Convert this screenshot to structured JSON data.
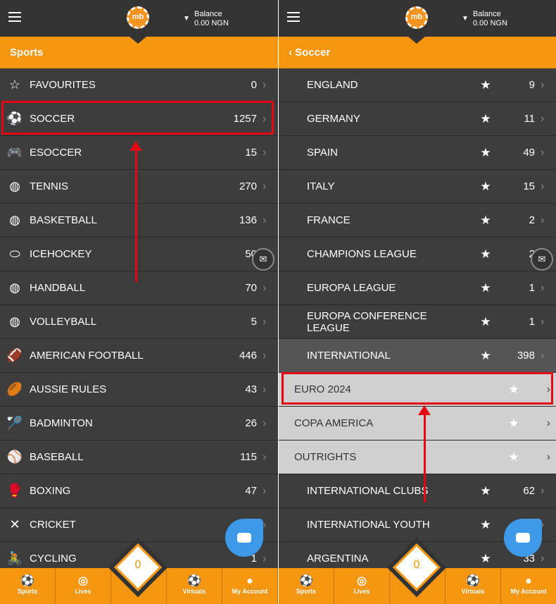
{
  "header": {
    "logo": "mb",
    "balance_label": "Balance",
    "balance_value": "0.00 NGN"
  },
  "left": {
    "title": "Sports",
    "items": [
      {
        "icon": "star-outline-icon",
        "glyph": "☆",
        "label": "FAVOURITES",
        "count": "0"
      },
      {
        "icon": "soccer-ball-icon",
        "glyph": "⚽",
        "label": "SOCCER",
        "count": "1257"
      },
      {
        "icon": "gamepad-icon",
        "glyph": "🎮",
        "label": "ESOCCER",
        "count": "15"
      },
      {
        "icon": "tennis-icon",
        "glyph": "◍",
        "label": "TENNIS",
        "count": "270"
      },
      {
        "icon": "basketball-icon",
        "glyph": "◍",
        "label": "BASKETBALL",
        "count": "136"
      },
      {
        "icon": "puck-icon",
        "glyph": "⬭",
        "label": "ICEHOCKEY",
        "count": "50"
      },
      {
        "icon": "handball-icon",
        "glyph": "◍",
        "label": "HANDBALL",
        "count": "70"
      },
      {
        "icon": "volleyball-icon",
        "glyph": "◍",
        "label": "VOLLEYBALL",
        "count": "5"
      },
      {
        "icon": "american-football-icon",
        "glyph": "🏈",
        "label": "AMERICAN FOOTBALL",
        "count": "446"
      },
      {
        "icon": "aussie-rules-icon",
        "glyph": "🏉",
        "label": "AUSSIE RULES",
        "count": "43"
      },
      {
        "icon": "shuttlecock-icon",
        "glyph": "🏸",
        "label": "BADMINTON",
        "count": "26"
      },
      {
        "icon": "baseball-icon",
        "glyph": "⚾",
        "label": "BASEBALL",
        "count": "115"
      },
      {
        "icon": "boxing-glove-icon",
        "glyph": "🥊",
        "label": "BOXING",
        "count": "47"
      },
      {
        "icon": "cricket-icon",
        "glyph": "✕",
        "label": "CRICKET",
        "count": "5"
      },
      {
        "icon": "cycling-icon",
        "glyph": "🚴",
        "label": "CYCLING",
        "count": "1"
      }
    ]
  },
  "right": {
    "title": "Soccer",
    "items": [
      {
        "label": "ENGLAND",
        "count": "9",
        "style": "dark"
      },
      {
        "label": "GERMANY",
        "count": "11",
        "style": "dark"
      },
      {
        "label": "SPAIN",
        "count": "49",
        "style": "dark"
      },
      {
        "label": "ITALY",
        "count": "15",
        "style": "dark"
      },
      {
        "label": "FRANCE",
        "count": "2",
        "style": "dark"
      },
      {
        "label": "CHAMPIONS LEAGUE",
        "count": "2",
        "style": "dark"
      },
      {
        "label": "EUROPA LEAGUE",
        "count": "1",
        "style": "dark"
      },
      {
        "label": "EUROPA CONFERENCE LEAGUE",
        "count": "1",
        "style": "dark"
      },
      {
        "label": "INTERNATIONAL",
        "count": "398",
        "style": "intl"
      },
      {
        "label": "EURO 2024",
        "count": "",
        "style": "light"
      },
      {
        "label": "COPA AMERICA",
        "count": "",
        "style": "light"
      },
      {
        "label": "OUTRIGHTS",
        "count": "",
        "style": "light"
      },
      {
        "label": "INTERNATIONAL CLUBS",
        "count": "62",
        "style": "dark"
      },
      {
        "label": "INTERNATIONAL YOUTH",
        "count": "1",
        "style": "dark"
      },
      {
        "label": "ARGENTINA",
        "count": "33",
        "style": "dark"
      }
    ]
  },
  "nav": [
    {
      "label": "Sports",
      "glyph": "⚽",
      "icon": "soccer-ball-icon"
    },
    {
      "label": "Lives",
      "glyph": "◎",
      "icon": "live-icon"
    },
    {
      "label": "",
      "glyph": "",
      "icon": ""
    },
    {
      "label": "Virtuals",
      "glyph": "⚽",
      "icon": "virtuals-icon"
    },
    {
      "label": "My Account",
      "glyph": "●",
      "icon": "account-icon"
    }
  ],
  "betslip_count": "0",
  "colors": {
    "accent": "#f7960f",
    "highlight": "#e30613",
    "chat": "#3d9ae8"
  }
}
